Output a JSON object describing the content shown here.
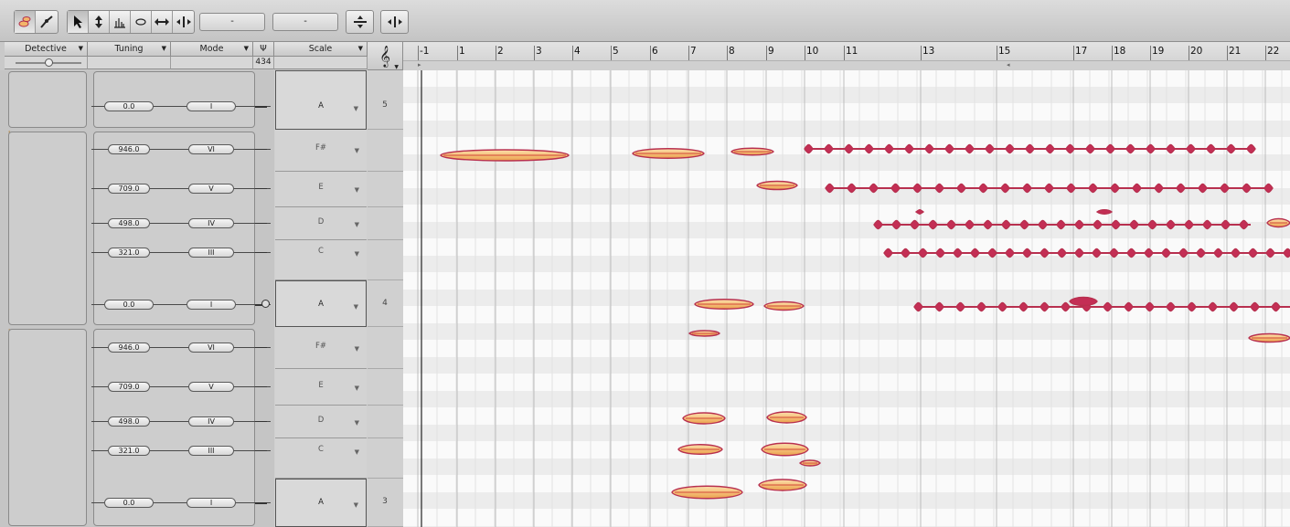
{
  "toolbar": {
    "tools": [
      {
        "icon": "note-blob-icon",
        "active": true
      },
      {
        "icon": "line-tool-icon",
        "active": false
      },
      {
        "icon": "arrow-cursor-icon",
        "active": true
      },
      {
        "icon": "pitch-tool-icon",
        "active": false
      },
      {
        "icon": "formant-tool-icon",
        "active": false
      },
      {
        "icon": "amplitude-tool-icon",
        "active": false
      },
      {
        "icon": "time-tool-icon",
        "active": false
      },
      {
        "icon": "separation-tool-icon",
        "active": false
      }
    ],
    "field1": "-",
    "field2": "-"
  },
  "columns": {
    "detective": "Detective",
    "tuning": "Tuning",
    "mode": "Mode",
    "scale": "Scale",
    "reference_pitch": "434"
  },
  "ruler_labels": [
    "-1",
    "1",
    "2",
    "3",
    "4",
    "5",
    "6",
    "7",
    "8",
    "9",
    "10",
    "11",
    "13",
    "15",
    "17",
    "18",
    "19",
    "20",
    "21",
    "22"
  ],
  "tuning_rows": [
    {
      "cents": "0.0",
      "mode": "I"
    },
    {
      "cents": "946.0",
      "mode": "VI"
    },
    {
      "cents": "709.0",
      "mode": "V"
    },
    {
      "cents": "498.0",
      "mode": "IV"
    },
    {
      "cents": "321.0",
      "mode": "III"
    },
    {
      "cents": "0.0",
      "mode": "I"
    },
    {
      "cents": "946.0",
      "mode": "VI"
    },
    {
      "cents": "709.0",
      "mode": "V"
    },
    {
      "cents": "498.0",
      "mode": "IV"
    },
    {
      "cents": "321.0",
      "mode": "III"
    },
    {
      "cents": "0.0",
      "mode": "I"
    }
  ],
  "scale_rows": [
    {
      "note": "A",
      "octave": "5",
      "root": true
    },
    {
      "note": "F#",
      "octave": "",
      "root": false
    },
    {
      "note": "E",
      "octave": "",
      "root": false
    },
    {
      "note": "D",
      "octave": "",
      "root": false
    },
    {
      "note": "C",
      "octave": "",
      "root": false
    },
    {
      "note": "A",
      "octave": "4",
      "root": true
    },
    {
      "note": "F#",
      "octave": "",
      "root": false
    },
    {
      "note": "E",
      "octave": "",
      "root": false
    },
    {
      "note": "D",
      "octave": "",
      "root": false
    },
    {
      "note": "C",
      "octave": "",
      "root": false
    },
    {
      "note": "A",
      "octave": "3",
      "root": true
    }
  ],
  "colors": {
    "note_outline": "#b8304f",
    "note_fill": "#f6c27a",
    "detective_peak": "#f2a640"
  }
}
